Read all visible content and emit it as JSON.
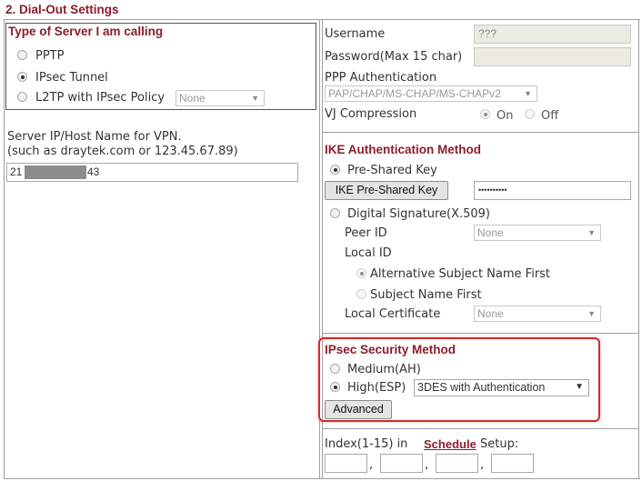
{
  "header": {
    "title": "2. Dial-Out Settings"
  },
  "server_type": {
    "title": "Type of Server I am calling",
    "options": [
      "PPTP",
      "IPsec Tunnel",
      "L2TP with IPsec Policy"
    ],
    "selected": "IPsec Tunnel",
    "l2tp_policy_value": "None"
  },
  "server_host": {
    "label_line1": "Server IP/Host Name for VPN.",
    "label_line2": "(such as draytek.com or 123.45.67.89)",
    "value_prefix": "21",
    "value_suffix": "43"
  },
  "ppp": {
    "username_label": "Username",
    "username_value": "???",
    "password_label": "Password(Max 15 char)",
    "password_value": "",
    "auth_label": "PPP Authentication",
    "auth_value": "PAP/CHAP/MS-CHAP/MS-CHAPv2",
    "vj_label": "VJ Compression",
    "vj_on": "On",
    "vj_off": "Off",
    "vj_selected": "On"
  },
  "ike": {
    "title": "IKE Authentication Method",
    "psk_label": "Pre-Shared Key",
    "psk_button": "IKE Pre-Shared Key",
    "psk_value": "••••••••••",
    "digsig_label": "Digital Signature(X.509)",
    "peer_id_label": "Peer ID",
    "peer_id_value": "None",
    "local_id_label": "Local ID",
    "alt_subject_label": "Alternative Subject Name First",
    "subject_label": "Subject Name First",
    "local_cert_label": "Local Certificate",
    "local_cert_value": "None"
  },
  "ipsec": {
    "title": "IPsec Security Method",
    "medium_label": "Medium(AH)",
    "high_label": "High(ESP)",
    "high_value": "3DES with Authentication",
    "advanced_button": "Advanced",
    "selected": "High(ESP)"
  },
  "schedule": {
    "label_prefix": "Index(1-15) in",
    "link": "Schedule",
    "label_suffix": "Setup:",
    "separator": ","
  },
  "colors": {
    "accent": "#8b1d2c",
    "highlight": "#d42a2a"
  }
}
